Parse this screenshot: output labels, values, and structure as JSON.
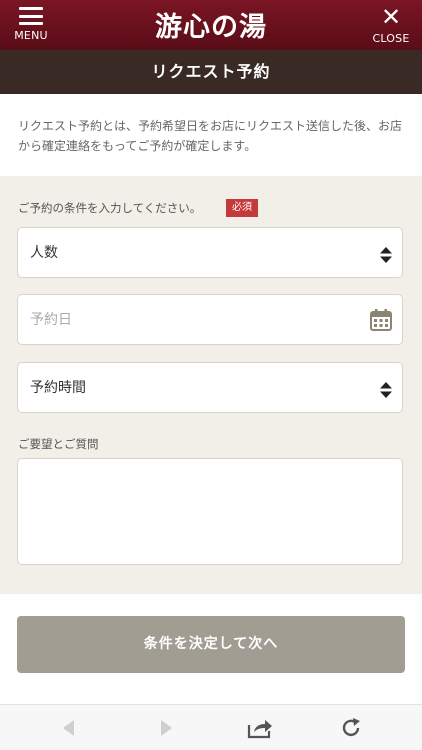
{
  "header": {
    "menu_label": "MENU",
    "logo_text": "游心の湯",
    "close_label": "CLOSE"
  },
  "page_title": "リクエスト予約",
  "intro_text": "リクエスト予約とは、予約希望日をお店にリクエスト送信した後、お店から確定連絡をもってご予約が確定します。",
  "form": {
    "condition_label": "ご予約の条件を入力してください。",
    "required_badge": "必須",
    "people_value": "人数",
    "date_placeholder": "予約日",
    "time_value": "予約時間",
    "comment_label": "ご要望とご質問",
    "comment_value": ""
  },
  "submit_label": "条件を決定して次へ",
  "icons": {
    "menu": "hamburger-icon",
    "close": "close-icon",
    "select": "updown-arrows-icon",
    "calendar": "calendar-icon",
    "back": "back-arrow-icon",
    "forward": "forward-arrow-icon",
    "share": "share-icon",
    "reload": "reload-icon"
  },
  "colors": {
    "header_bg": "#6a111e",
    "title_bg": "#3a2a25",
    "form_bg": "#f2efe9",
    "required": "#c43a3a",
    "submit_bg": "#a19d92"
  }
}
